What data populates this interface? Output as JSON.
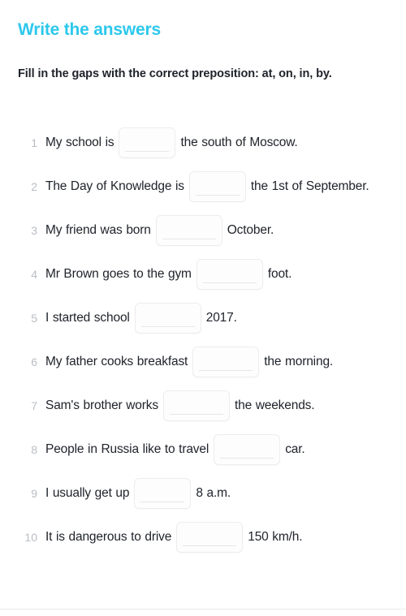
{
  "header": {
    "title": "Write the answers",
    "prompt": "Fill in the gaps with the correct preposition: at, on, in, by."
  },
  "accent_color": "#2cc8ec",
  "text_color": "#20242b",
  "number_color": "#b9bdc4",
  "input_border_color": "#ededee",
  "input_rule_color": "#e6e7e9",
  "divider_color": "#ececee",
  "exercise": {
    "kind": "fill-in-the-blank",
    "blank_value": "",
    "blank_placeholder": "",
    "items": [
      {
        "number": "1",
        "before": "My school is",
        "after": "the south of Moscow.",
        "value": "",
        "width": "narrow"
      },
      {
        "number": "2",
        "before": "The Day of Knowledge is",
        "after": "the 1st of September.",
        "value": "",
        "width": "narrow"
      },
      {
        "number": "3",
        "before": "My friend was born",
        "after": "October.",
        "value": "",
        "width": "wide"
      },
      {
        "number": "4",
        "before": "Mr Brown goes to the gym",
        "after": "foot.",
        "value": "",
        "width": "wide"
      },
      {
        "number": "5",
        "before": "I started school",
        "after": "2017.",
        "value": "",
        "width": "wide"
      },
      {
        "number": "6",
        "before": "My father cooks breakfast",
        "after": "the morning.",
        "value": "",
        "width": "wide"
      },
      {
        "number": "7",
        "before": "Sam's brother works",
        "after": "the weekends.",
        "value": "",
        "width": "wide"
      },
      {
        "number": "8",
        "before": "People in Russia like to travel",
        "after": "car.",
        "value": "",
        "width": "wide"
      },
      {
        "number": "9",
        "before": "I usually get up",
        "after": "8 a.m.",
        "value": "",
        "width": "narrow"
      },
      {
        "number": "10",
        "before": "It is dangerous to drive",
        "after": "150 km/h.",
        "value": "",
        "width": "wide"
      }
    ]
  }
}
